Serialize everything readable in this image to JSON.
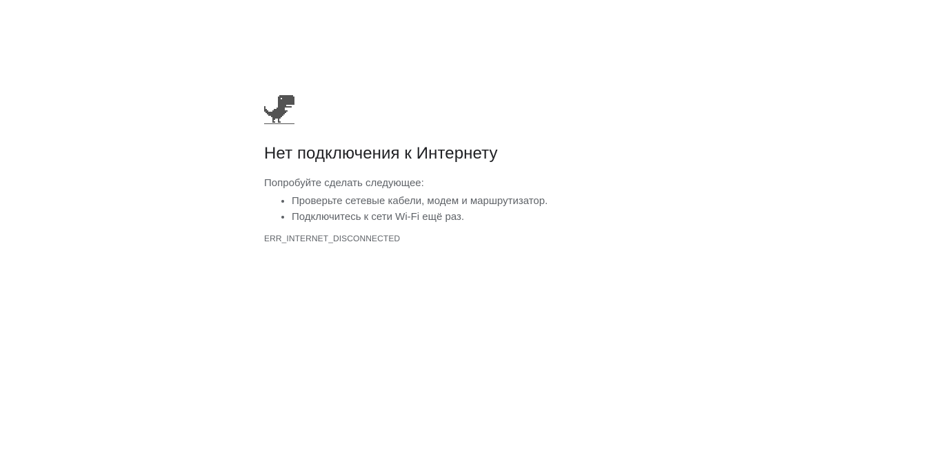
{
  "page": {
    "icon": "offline-dino-icon",
    "heading": "Нет подключения к Интернету",
    "summary": "Попробуйте сделать следующее:",
    "suggestions": [
      "Проверьте сетевые кабели, модем и маршрутизатор.",
      "Подключитесь к сети Wi-Fi ещё раз."
    ],
    "error_code": "ERR_INTERNET_DISCONNECTED"
  },
  "colors": {
    "background": "#ffffff",
    "heading": "#202124",
    "body_text": "#5f6368",
    "dino": "#535353"
  }
}
